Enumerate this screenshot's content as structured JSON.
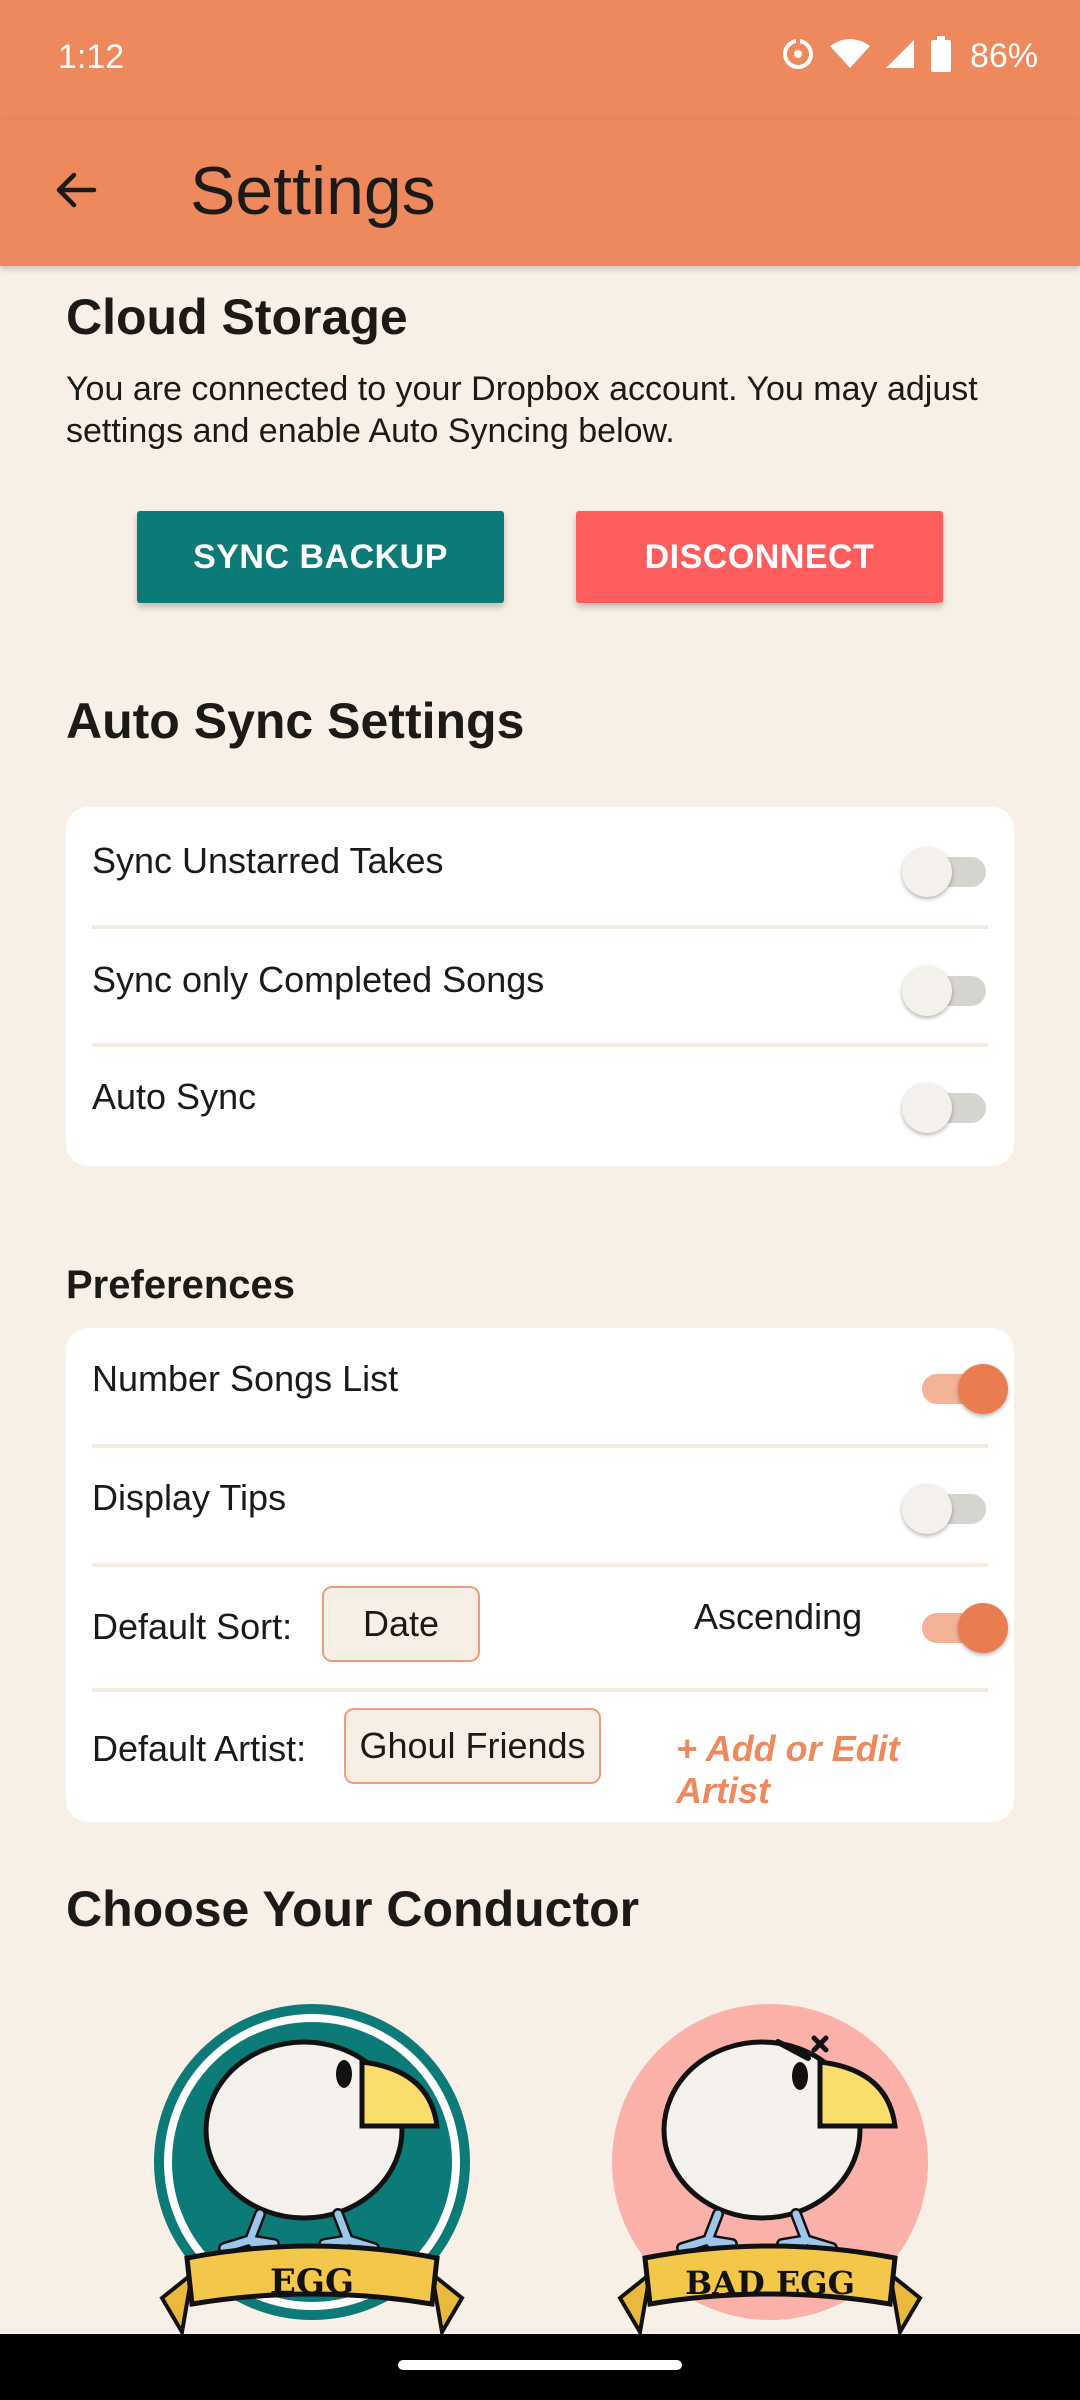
{
  "status_bar": {
    "time": "1:12",
    "battery_pct": "86%"
  },
  "app_bar": {
    "title": "Settings"
  },
  "cloud_storage": {
    "heading": "Cloud Storage",
    "description": "You are connected to your Dropbox account. You may adjust settings and enable Auto Syncing below.",
    "sync_button": "SYNC BACKUP",
    "disconnect_button": "DISCONNECT"
  },
  "auto_sync": {
    "heading": "Auto Sync Settings",
    "items": [
      {
        "label": "Sync Unstarred Takes",
        "enabled": false
      },
      {
        "label": "Sync only Completed Songs",
        "enabled": false
      },
      {
        "label": "Auto Sync",
        "enabled": false
      }
    ]
  },
  "preferences": {
    "heading": "Preferences",
    "number_songs": {
      "label": "Number Songs List",
      "enabled": true
    },
    "display_tips": {
      "label": "Display Tips",
      "enabled": false
    },
    "default_sort": {
      "label": "Default Sort:",
      "value": "Date",
      "order_label": "Ascending",
      "ascending": true
    },
    "default_artist": {
      "label": "Default Artist:",
      "value": "Ghoul Friends",
      "edit_link": "+ Add or Edit Artist"
    }
  },
  "conductor": {
    "heading": "Choose Your Conductor",
    "options": [
      {
        "name": "EGG",
        "selected": true
      },
      {
        "name": "BAD EGG",
        "selected": false
      }
    ]
  },
  "colors": {
    "accent_orange": "#ee895d",
    "teal": "#0c7a76",
    "danger_red": "#fd5d5d",
    "background": "#f8efe6"
  }
}
